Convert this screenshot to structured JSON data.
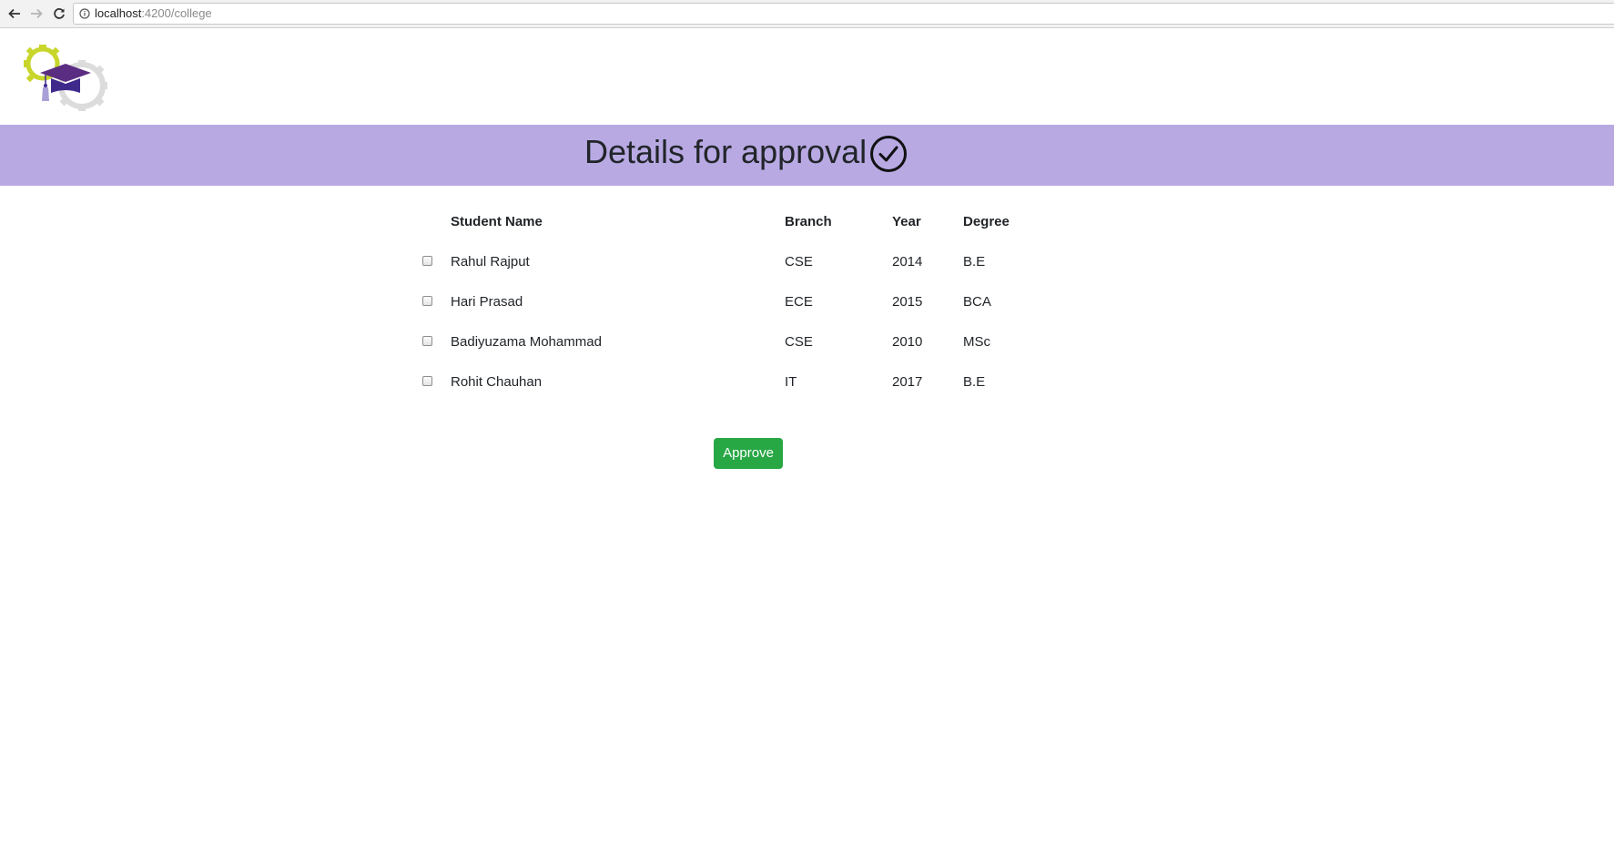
{
  "browser": {
    "url_host": "localhost",
    "url_path": ":4200/college",
    "back_icon": "arrow-left-icon",
    "forward_icon": "arrow-right-icon",
    "reload_icon": "reload-icon",
    "info_icon": "info-icon"
  },
  "logo": {
    "icon": "graduation-cap-gears-logo",
    "colors": {
      "cap": "#5b2d82",
      "gear_left": "#c8d62b",
      "gear_right": "#d9d9d9"
    }
  },
  "banner": {
    "title": "Details for approval",
    "icon": "check-circle-icon",
    "background": "#b8a9e3"
  },
  "table": {
    "headers": {
      "name": "Student Name",
      "branch": "Branch",
      "year": "Year",
      "degree": "Degree"
    },
    "rows": [
      {
        "checked": false,
        "name": "Rahul Rajput",
        "branch": "CSE",
        "year": "2014",
        "degree": "B.E"
      },
      {
        "checked": false,
        "name": "Hari Prasad",
        "branch": "ECE",
        "year": "2015",
        "degree": "BCA"
      },
      {
        "checked": false,
        "name": "Badiyuzama Mohammad",
        "branch": "CSE",
        "year": "2010",
        "degree": "MSc"
      },
      {
        "checked": false,
        "name": "Rohit Chauhan",
        "branch": "IT",
        "year": "2017",
        "degree": "B.E"
      }
    ]
  },
  "approve_button": {
    "label": "Approve",
    "color": "#28a745"
  }
}
